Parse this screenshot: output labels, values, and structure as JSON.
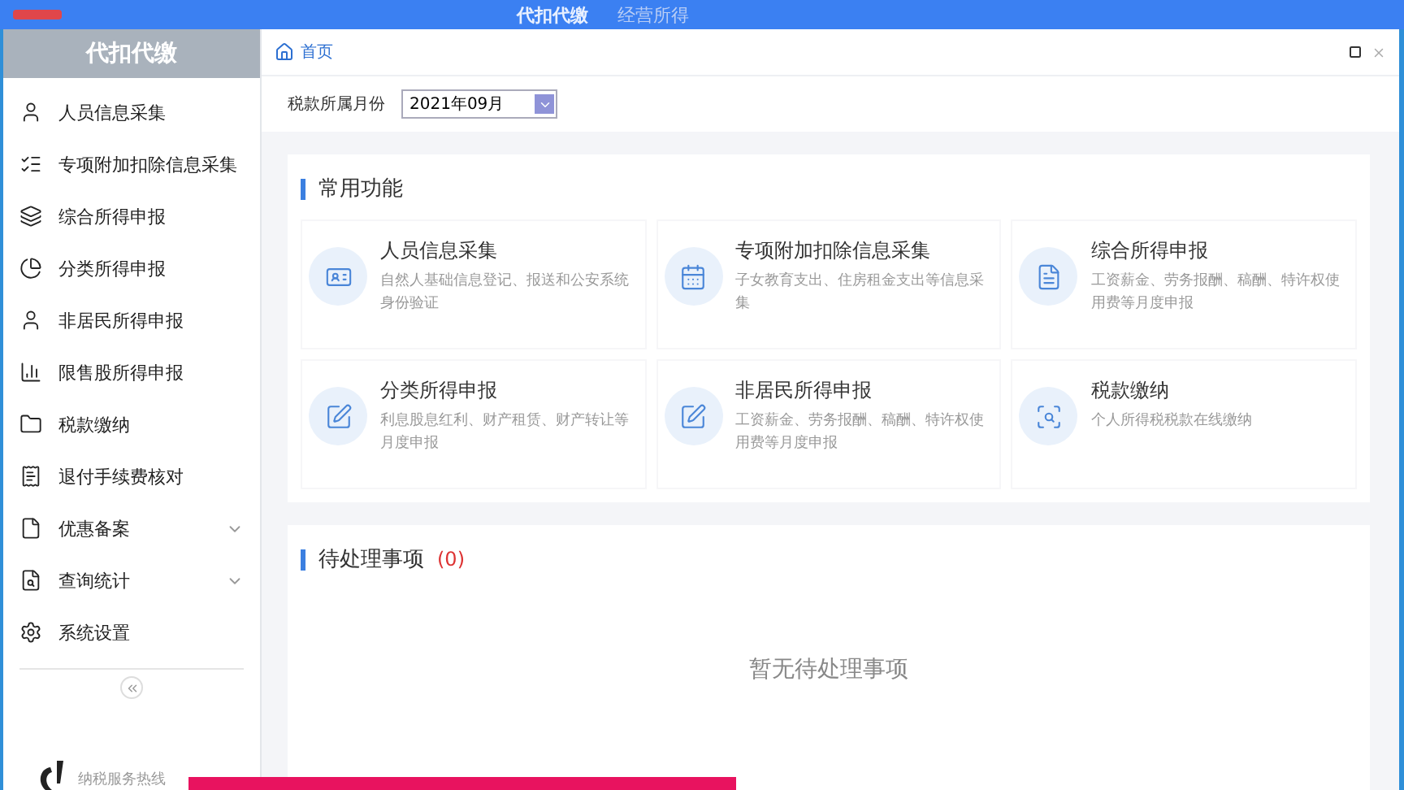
{
  "top_bar": {
    "nav": [
      {
        "label": "代扣代缴",
        "selected": true
      },
      {
        "label": "经营所得",
        "selected": false
      }
    ]
  },
  "sidebar": {
    "title": "代扣代缴",
    "items": [
      {
        "label": "人员信息采集",
        "submenu": false
      },
      {
        "label": "专项附加扣除信息采集",
        "submenu": false
      },
      {
        "label": "综合所得申报",
        "submenu": false
      },
      {
        "label": "分类所得申报",
        "submenu": false
      },
      {
        "label": "非居民所得申报",
        "submenu": false
      },
      {
        "label": "限售股所得申报",
        "submenu": false
      },
      {
        "label": "税款缴纳",
        "submenu": false
      },
      {
        "label": "退付手续费核对",
        "submenu": false
      },
      {
        "label": "优惠备案",
        "submenu": true
      },
      {
        "label": "查询统计",
        "submenu": true
      },
      {
        "label": "系统设置",
        "submenu": false
      }
    ],
    "hotline": "纳税服务热线"
  },
  "tab": {
    "label": "首页"
  },
  "filter": {
    "label": "税款所属月份",
    "value": "2021年09月"
  },
  "common": {
    "title": "常用功能",
    "items": [
      {
        "title": "人员信息采集",
        "desc": "自然人基础信息登记、报送和公安系统身份验证"
      },
      {
        "title": "专项附加扣除信息采集",
        "desc": "子女教育支出、住房租金支出等信息采集"
      },
      {
        "title": "综合所得申报",
        "desc": "工资薪金、劳务报酬、稿酬、特许权使用费等月度申报"
      },
      {
        "title": "分类所得申报",
        "desc": "利息股息红利、财产租赁、财产转让等月度申报"
      },
      {
        "title": "非居民所得申报",
        "desc": "工资薪金、劳务报酬、稿酬、特许权使用费等月度申报"
      },
      {
        "title": "税款缴纳",
        "desc": "个人所得税税款在线缴纳"
      }
    ]
  },
  "pending": {
    "title": "待处理事项",
    "count": "(0)",
    "empty": "暂无待处理事项"
  }
}
